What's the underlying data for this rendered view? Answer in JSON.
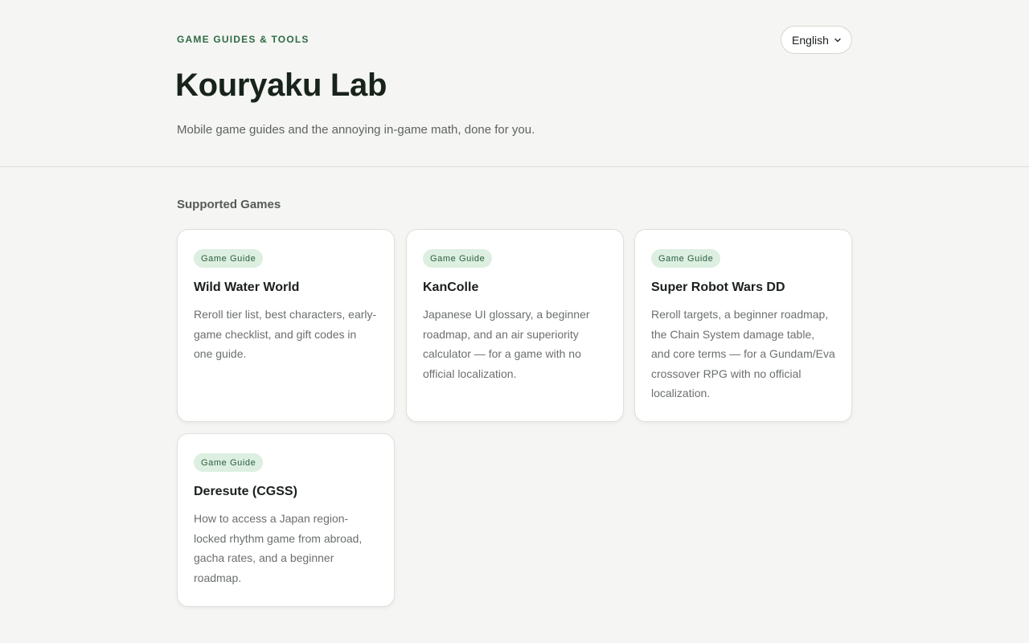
{
  "header": {
    "eyebrow": "GAME GUIDES & TOOLS",
    "title": "Kouryaku Lab",
    "tagline": "Mobile game guides and the annoying in-game math, done for you.",
    "language": {
      "selected": "English",
      "icon": "chevron-down-icon"
    }
  },
  "main": {
    "section_title": "Supported Games",
    "cards": [
      {
        "badge": "Game Guide",
        "title": "Wild Water World",
        "description": "Reroll tier list, best characters, early-game checklist, and gift codes in one guide."
      },
      {
        "badge": "Game Guide",
        "title": "KanColle",
        "description": "Japanese UI glossary, a beginner roadmap, and an air superiority calculator — for a game with no official localization."
      },
      {
        "badge": "Game Guide",
        "title": "Super Robot Wars DD",
        "description": "Reroll targets, a beginner roadmap, the Chain System damage table, and core terms — for a Gundam/Eva crossover RPG with no official localization."
      },
      {
        "badge": "Game Guide",
        "title": "Deresute (CGSS)",
        "description": "How to access a Japan region-locked rhythm game from abroad, gacha rates, and a beginner roadmap."
      }
    ]
  },
  "colors": {
    "accent": "#2f6b45",
    "badge_bg": "#dcefe1",
    "page_bg": "#f5f5f3"
  }
}
